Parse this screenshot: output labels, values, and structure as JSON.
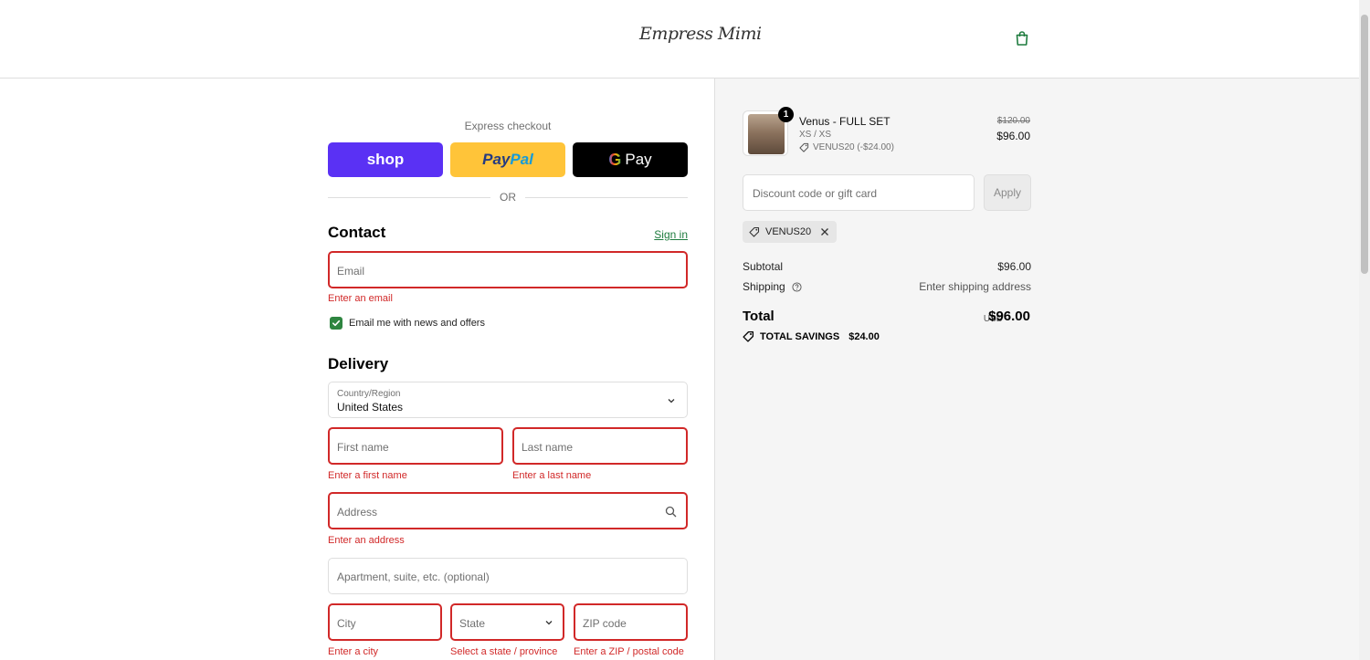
{
  "header": {
    "logo": "Empress Mimi",
    "cart_icon": "shopping-bag-icon",
    "accent": "#1f7c3f"
  },
  "express": {
    "title": "Express checkout",
    "shop_label": "shop",
    "paypal_label_a": "Pay",
    "paypal_label_b": "Pal",
    "gpay_label": "Pay",
    "gpay_g": "G",
    "or_label": "OR"
  },
  "contact": {
    "title": "Contact",
    "sign_in": "Sign in",
    "email_placeholder": "Email",
    "email_error": "Enter an email",
    "newsletter_label": "Email me with news and offers",
    "newsletter_checked": true
  },
  "delivery": {
    "title": "Delivery",
    "country_label": "Country/Region",
    "country_value": "United States",
    "first_name_placeholder": "First name",
    "first_name_error": "Enter a first name",
    "last_name_placeholder": "Last name",
    "last_name_error": "Enter a last name",
    "address_placeholder": "Address",
    "address_error": "Enter an address",
    "apartment_placeholder": "Apartment, suite, etc. (optional)",
    "city_placeholder": "City",
    "city_error": "Enter a city",
    "state_placeholder": "State",
    "state_error": "Select a state / province",
    "zip_placeholder": "ZIP code",
    "zip_error": "Enter a ZIP / postal code",
    "error_color": "#d12828"
  },
  "summary": {
    "product": {
      "quantity": "1",
      "name": "Venus - FULL SET",
      "variant": "XS / XS",
      "discount": "VENUS20 (-$24.00)",
      "original_price": "$120.00",
      "price": "$96.00"
    },
    "discount_placeholder": "Discount code or gift card",
    "apply_label": "Apply",
    "applied_code": "VENUS20",
    "subtotal_label": "Subtotal",
    "subtotal_value": "$96.00",
    "shipping_label": "Shipping",
    "shipping_value": "Enter shipping address",
    "total_label": "Total",
    "total_currency": "USD",
    "total_value": "$96.00",
    "savings_label": "TOTAL SAVINGS",
    "savings_value": "$24.00"
  }
}
